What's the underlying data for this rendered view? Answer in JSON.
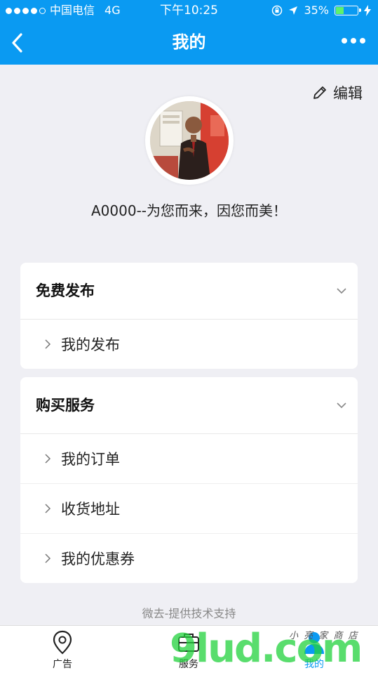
{
  "status_bar": {
    "carrier": "中国电信",
    "network": "4G",
    "time": "下午10:25",
    "battery": "35%"
  },
  "navbar": {
    "title": "我的"
  },
  "profile": {
    "edit_label": "编辑",
    "username": "A0000--为您而来，因您而美！"
  },
  "sections": [
    {
      "title": "免费发布",
      "items": [
        "我的发布"
      ]
    },
    {
      "title": "购买服务",
      "items": [
        "我的订单",
        "收货地址",
        "我的优惠券"
      ]
    }
  ],
  "footer": {
    "note": "微去-提供技术支持"
  },
  "tabbar": {
    "tabs": [
      {
        "label": "广告",
        "icon": "location-pin-icon"
      },
      {
        "label": "服务",
        "icon": "service-icon"
      },
      {
        "label": "我的",
        "icon": "person-icon"
      }
    ],
    "active_index": 2
  },
  "watermark": {
    "text": "9lud.com",
    "sub": "小 亮 家 商 店"
  },
  "colors": {
    "primary": "#0a9af2",
    "background": "#efeff4"
  }
}
